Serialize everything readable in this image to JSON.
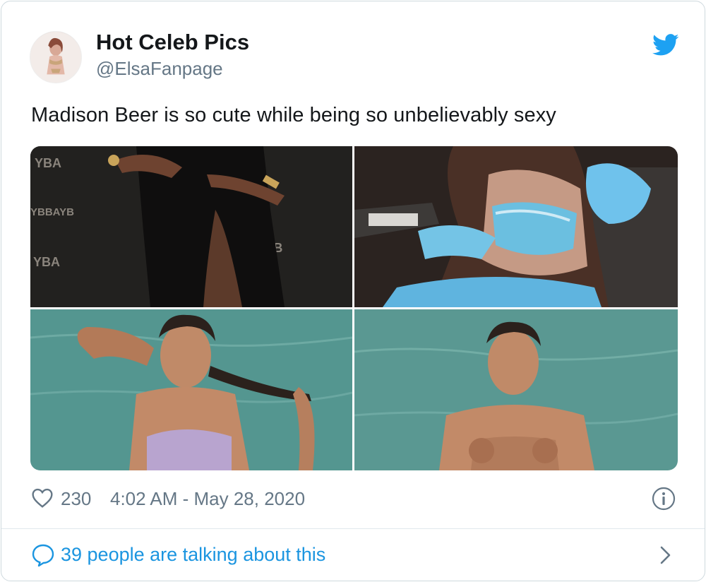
{
  "tweet": {
    "display_name": "Hot Celeb Pics",
    "handle": "@ElsaFanpage",
    "text": "Madison Beer is so cute while being so unbelievably sexy",
    "likes": "230",
    "timestamp": "4:02 AM - May 28, 2020",
    "conversation_label": "39 people are talking about this"
  },
  "media": {
    "photo_count": 4,
    "tile_1_wall_text": [
      "YBA",
      "YBBAYB",
      "BAYB",
      "YBA"
    ]
  },
  "colors": {
    "twitter_blue": "#1da1f2",
    "link_blue": "#1b95e0",
    "muted_text": "#657786",
    "border": "#cfd9de"
  },
  "icons": [
    "twitter-bird-icon",
    "heart-icon",
    "info-icon",
    "speech-bubble-icon",
    "chevron-right-icon"
  ]
}
